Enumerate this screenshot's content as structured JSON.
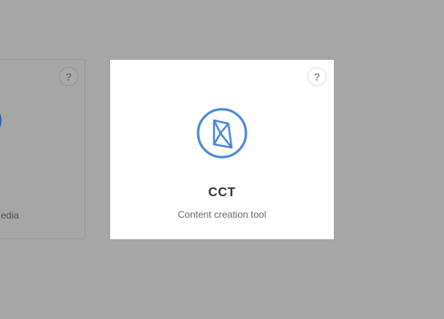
{
  "cards": [
    {
      "id": "media",
      "description": "edia",
      "help_label": "?",
      "icon": "media-icon"
    },
    {
      "id": "cct",
      "title": "CCT",
      "description": "Content creation tool",
      "help_label": "?",
      "icon": "cct-logo-icon"
    }
  ],
  "colors": {
    "backdrop": "#a6a6a6",
    "accent": "#4a8ad8",
    "card_bg": "#ffffff"
  }
}
